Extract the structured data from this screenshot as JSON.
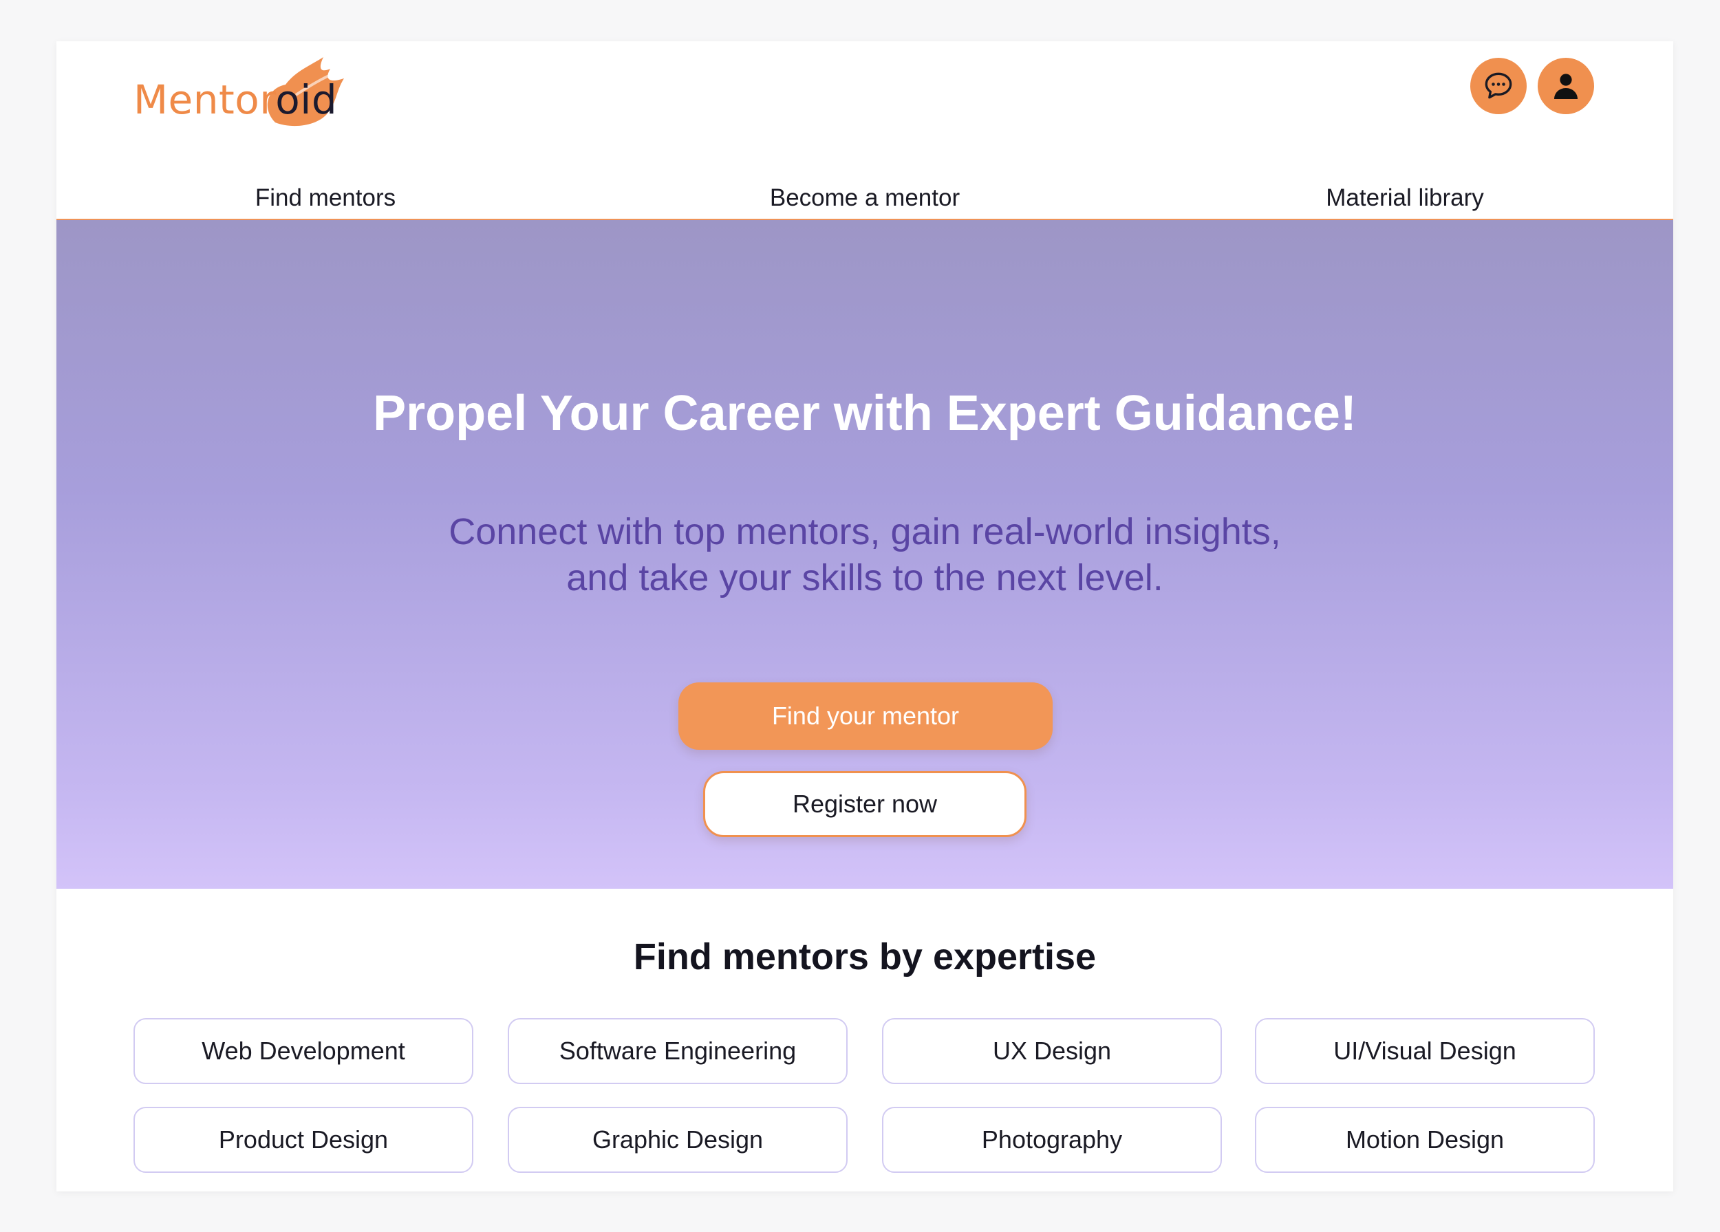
{
  "header": {
    "logo": {
      "part1": "Mentor",
      "part2": "oid"
    },
    "nav": [
      "Find mentors",
      "Become a mentor",
      "Material library"
    ],
    "icons": {
      "chat": "chat-bubble-icon",
      "profile": "user-icon"
    }
  },
  "hero": {
    "title": "Propel Your Career with Expert Guidance!",
    "subtitle_line1": "Connect with top mentors, gain real-world insights,",
    "subtitle_line2": "and take your skills to the next level.",
    "primary_cta": "Find your mentor",
    "secondary_cta": "Register now"
  },
  "expertise": {
    "title": "Find mentors by expertise",
    "items": [
      "Web Development",
      "Software Engineering",
      "UX Design",
      "UI/Visual Design",
      "Product Design",
      "Graphic Design",
      "Photography",
      "Motion Design"
    ]
  },
  "colors": {
    "accent": "#f0904f",
    "hero_top": "#9d96c6",
    "hero_bottom": "#d3c3f9",
    "subtitle": "#5a45a4",
    "chip_border": "#d2cbf2"
  }
}
